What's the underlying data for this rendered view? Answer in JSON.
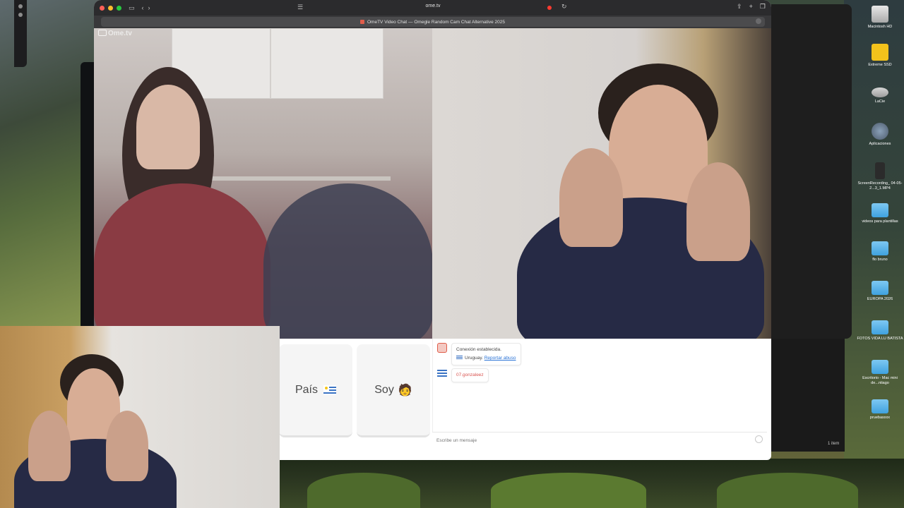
{
  "browser": {
    "url": "ome.tv",
    "tab_title": "OmeTV Video Chat — Omegle Random Cam Chat Alternative 2025"
  },
  "site": {
    "logo": "Ome.tv"
  },
  "controls": {
    "country_label": "País",
    "gender_label": "Soy",
    "gender_emoji": "🧑"
  },
  "chat": {
    "messages": [
      {
        "line1": "Conexión establecida.",
        "country": "Uruguay.",
        "report_link": "Reportar abuso"
      },
      {
        "username": "07.gonzaleez"
      }
    ],
    "input_placeholder": "Escribe un mensaje"
  },
  "finder": {
    "item_count": "1 item"
  },
  "desktop": {
    "icons": [
      {
        "label": "Macintosh HD",
        "icon": "hard-drive-icon"
      },
      {
        "label": "Extreme SSD",
        "icon": "ssd-icon"
      },
      {
        "label": "LaCie",
        "icon": "external-drive-icon"
      },
      {
        "label": "Aplicaciones",
        "icon": "applications-icon"
      },
      {
        "label": "ScreenRecording_ 04-05-2...3_1.MP4",
        "icon": "video-file-icon"
      },
      {
        "label": "videos para plantillas",
        "icon": "folder-icon"
      },
      {
        "label": "flo bruno",
        "icon": "folder-icon"
      },
      {
        "label": "EUROPA 2026",
        "icon": "folder-icon"
      },
      {
        "label": "FOTOS VIDA LU BATISTA",
        "icon": "folder-icon"
      },
      {
        "label": "Escritorio - Mac mini de...ntiago",
        "icon": "folder-icon"
      },
      {
        "label": "pruebasxxx",
        "icon": "folder-icon"
      }
    ]
  },
  "colors": {
    "accent_red": "#ff5f57",
    "link_blue": "#2a73d6",
    "folder_blue": "#3fa2df"
  }
}
